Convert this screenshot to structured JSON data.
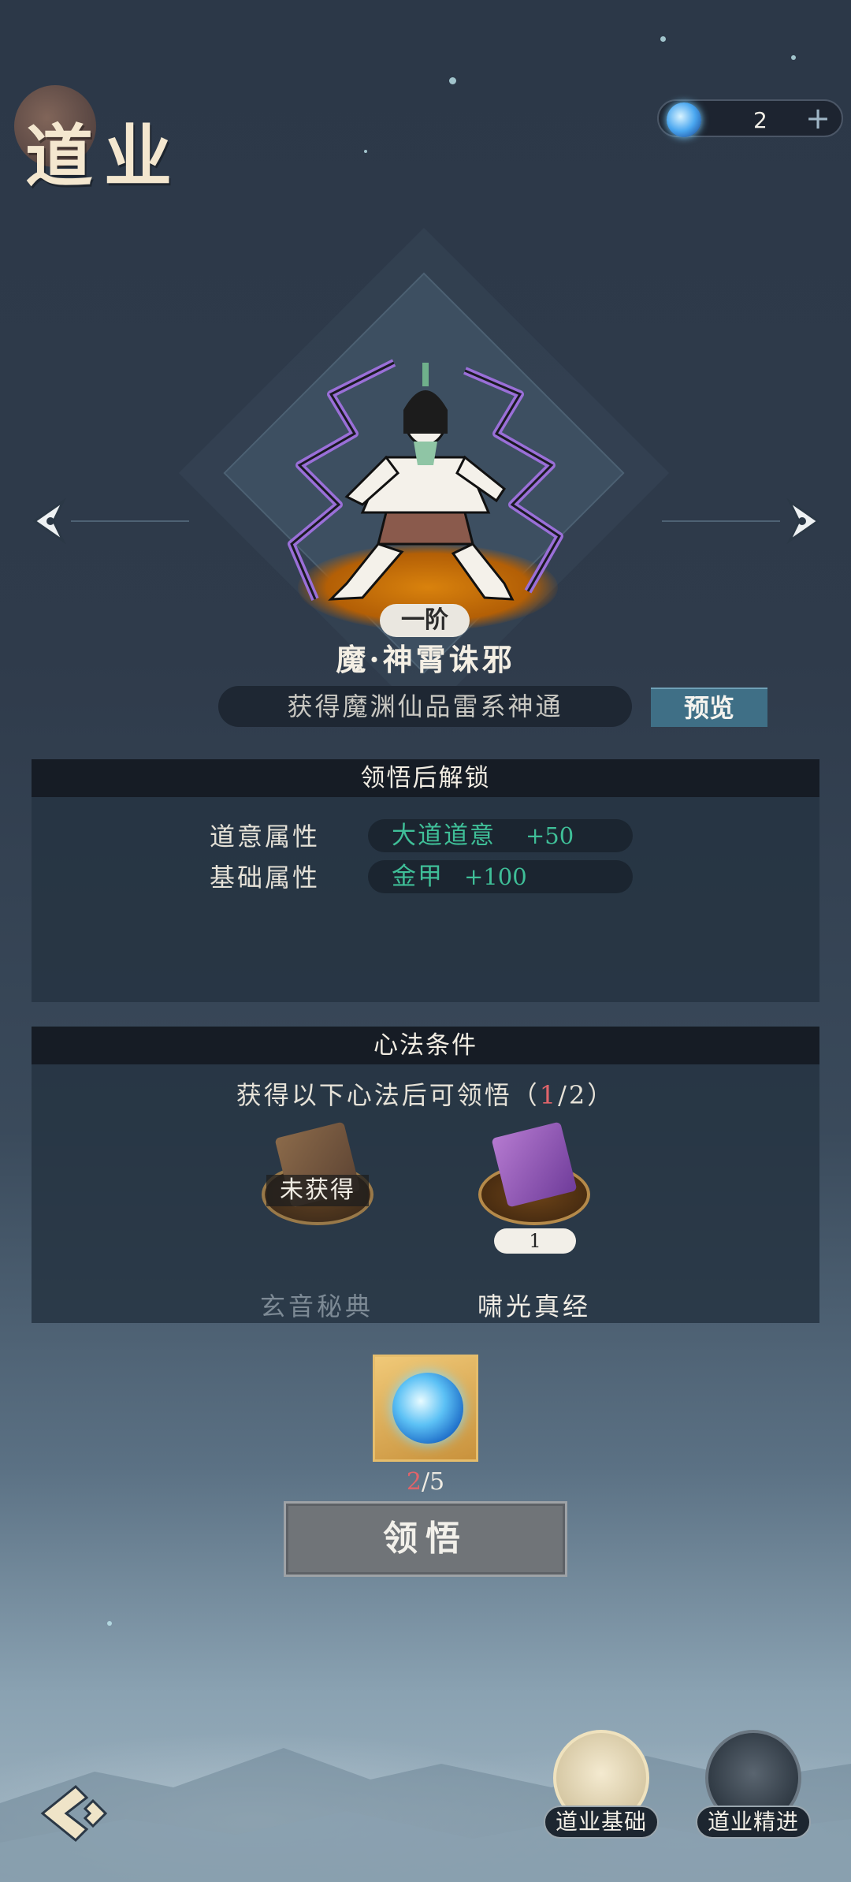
{
  "header": {
    "title": "道业",
    "currency": {
      "icon": "spirit-orb-icon",
      "count": "2",
      "plus": "+"
    }
  },
  "skill": {
    "rank": "一阶",
    "name": "魔·神霄诛邪",
    "description": "获得魔渊仙品雷系神通",
    "preview_label": "预览"
  },
  "unlock_panel": {
    "title": "领悟后解锁",
    "rows": [
      {
        "label": "道意属性",
        "name": "大道道意",
        "value": "+50"
      },
      {
        "label": "基础属性",
        "name": "金甲",
        "value": "+100"
      }
    ]
  },
  "condition_panel": {
    "title": "心法条件",
    "hint_prefix": "获得以下心法后可领悟（",
    "hint_current": "1",
    "hint_suffix": "/2）",
    "books": [
      {
        "name": "玄音秘典",
        "status": "未获得",
        "acquired": false
      },
      {
        "name": "啸光真经",
        "level": "1",
        "acquired": true
      }
    ]
  },
  "cost": {
    "current": "2",
    "total": "/5"
  },
  "action": {
    "label": "领悟"
  },
  "bottom_nav": {
    "basics_label": "道业基础",
    "advanced_label": "道业精进"
  },
  "colors": {
    "accent_green": "#3fbf98",
    "highlight_red": "#e0646a",
    "preview_blue": "#3f6f86"
  }
}
